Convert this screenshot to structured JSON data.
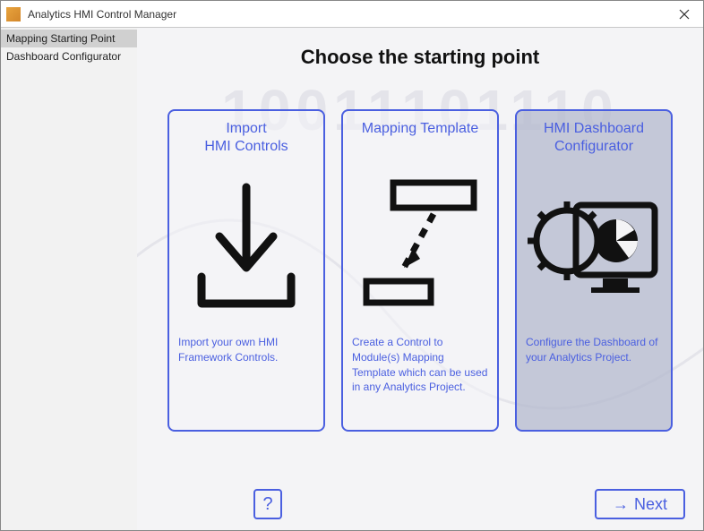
{
  "window": {
    "title": "Analytics HMI Control Manager"
  },
  "sidebar": {
    "items": [
      {
        "label": "Mapping Starting Point",
        "active": true
      },
      {
        "label": "Dashboard Configurator",
        "active": false
      }
    ]
  },
  "main": {
    "headline": "Choose the starting point",
    "bg_digits": "10011101110",
    "cards": [
      {
        "title": "Import\nHMI Controls",
        "description": "Import your own HMI Framework Controls.",
        "icon": "download-icon",
        "selected": false
      },
      {
        "title": "Mapping Template",
        "description": "Create a Control to Module(s) Mapping Template which can be used in any Analytics Project.",
        "icon": "mapping-icon",
        "selected": false
      },
      {
        "title": "HMI Dashboard Configurator",
        "description": "Configure the Dashboard of your Analytics Project.",
        "icon": "dashboard-icon",
        "selected": true
      }
    ]
  },
  "footer": {
    "help_label": "?",
    "next_label": "Next"
  }
}
